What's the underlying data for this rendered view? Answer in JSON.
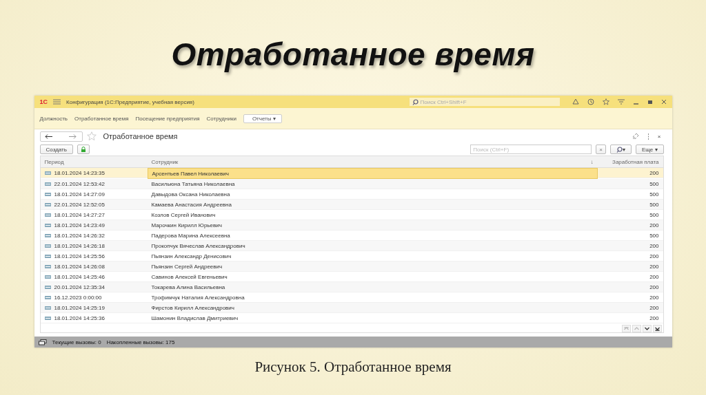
{
  "slide": {
    "title": "Отработанное время",
    "caption": "Рисунок 5. Отработанное время"
  },
  "app": {
    "logo": "1С",
    "title": "Конфигурация  (1С:Предприятие, учебная версия)",
    "search_placeholder": "Поиск Ctrl+Shift+F"
  },
  "sections": [
    {
      "kind": "link",
      "label": "Должность"
    },
    {
      "kind": "link",
      "label": "Отработанное время"
    },
    {
      "kind": "link",
      "label": "Посещение предприятия"
    },
    {
      "kind": "link",
      "label": "Сотрудники"
    },
    {
      "kind": "dropdown",
      "label": "Отчеты ▾"
    }
  ],
  "form": {
    "title": "Отработанное время",
    "create_button": "Создать",
    "search_placeholder": "Поиск (Ctrl+F)",
    "clear": "×",
    "search_caret": "▾",
    "more_button": "Еще ▾",
    "close": "×"
  },
  "table": {
    "columns": [
      {
        "label": "Период"
      },
      {
        "label": "Сотрудник",
        "sort": "↓"
      },
      {
        "label": "Заработная плата"
      }
    ],
    "rows": [
      {
        "period": "18.01.2024 14:23:35",
        "employee": "Арсентьев Павел Николаевич",
        "salary": "200",
        "selected": true
      },
      {
        "period": "22.01.2024 12:53:42",
        "employee": "Васильюна Татьяна Николаевна",
        "salary": "500",
        "selected": false
      },
      {
        "period": "18.01.2024 14:27:09",
        "employee": "Давыдова Оксана Николаевна",
        "salary": "500",
        "selected": false
      },
      {
        "period": "22.01.2024 12:52:05",
        "employee": "Камаева Анастасия Андреевна",
        "salary": "500",
        "selected": false
      },
      {
        "period": "18.01.2024 14:27:27",
        "employee": "Козлов Сергей Иванович",
        "salary": "500",
        "selected": false
      },
      {
        "period": "18.01.2024 14:23:49",
        "employee": "Марочкин Кирилл Юрьевич",
        "salary": "200",
        "selected": false
      },
      {
        "period": "18.01.2024 14:26:32",
        "employee": "Падерова Марина Алексеевна",
        "salary": "500",
        "selected": false
      },
      {
        "period": "18.01.2024 14:26:18",
        "employee": "Прокопчук Вячеслав Александрович",
        "salary": "200",
        "selected": false
      },
      {
        "period": "18.01.2024 14:25:56",
        "employee": "Пьянзин Александр Денисович",
        "salary": "200",
        "selected": false
      },
      {
        "period": "18.01.2024 14:26:08",
        "employee": "Пьянзин Сергей Андреевич",
        "salary": "200",
        "selected": false
      },
      {
        "period": "18.01.2024 14:25:46",
        "employee": "Савинов Алексей Евгеньевич",
        "salary": "200",
        "selected": false
      },
      {
        "period": "20.01.2024 12:35:34",
        "employee": "Токарева Алина Васильевна",
        "salary": "200",
        "selected": false
      },
      {
        "period": "16.12.2023 0:00:00",
        "employee": "Трофимчук Наталия Александровна",
        "salary": "200",
        "selected": false
      },
      {
        "period": "18.01.2024 14:25:19",
        "employee": "Фирстов Кирилл Александрович",
        "salary": "200",
        "selected": false
      },
      {
        "period": "18.01.2024 14:25:36",
        "employee": "Шамонин Владислав Дмитриевич",
        "salary": "200",
        "selected": false
      }
    ]
  },
  "status_bar": {
    "current_calls": "Текущие вызовы: 0",
    "accumulated_calls": "Накопленные вызовы: 175"
  }
}
